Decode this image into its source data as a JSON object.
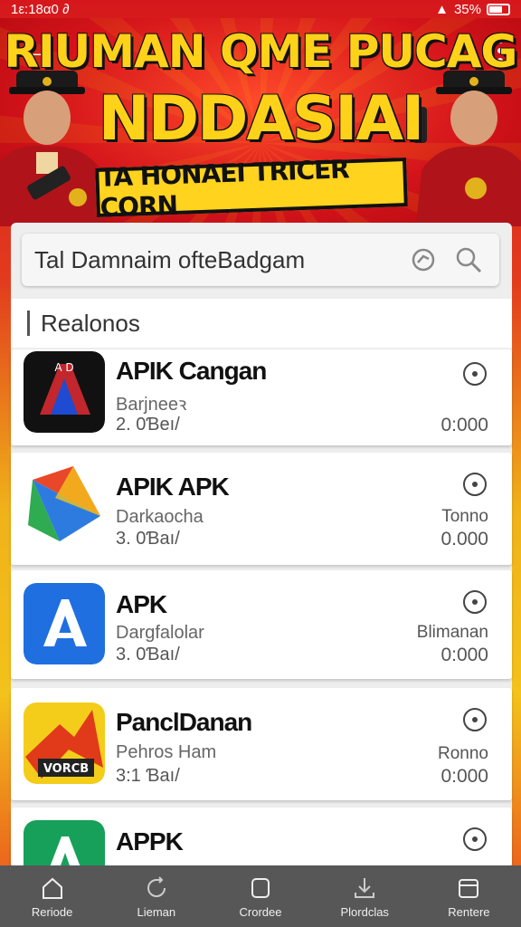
{
  "status": {
    "time": "1ε:18α0 ∂",
    "battery": "35%"
  },
  "banner": {
    "title_line1": "RIUMAN QME PUCAG",
    "title_line2": "NDDASIAI",
    "tagline": "TA HONAEI TRICER CORN"
  },
  "search": {
    "placeholder": "Tal Damnaim ofteBadgam"
  },
  "section": {
    "label": "Realonos"
  },
  "apps": [
    {
      "name": "APIK Cangan",
      "developer": "Barjneeꝛ",
      "size": "2. 0Ɓeı/",
      "extra": "",
      "count": "0:000",
      "icon": "apk-cangan-icon"
    },
    {
      "name": "APIK APK",
      "developer": "Darkaocha",
      "size": "3. 0Ɓaı/",
      "extra": "Tonno",
      "count": "0.000",
      "icon": "apk-triangle-icon"
    },
    {
      "name": "APK",
      "developer": "Dargfalolar",
      "size": "3. 0Ɓaı/",
      "extra": "Blimanan",
      "count": "0:000",
      "icon": "apk-blue-icon"
    },
    {
      "name": "PanclDanan",
      "developer": "Pehros Ham",
      "size": "3:1 Ɓaı/",
      "extra": "Ronno",
      "count": "0:000",
      "icon": "vorcb-icon"
    },
    {
      "name": "APPK",
      "developer": "",
      "size": "",
      "extra": "",
      "count": "",
      "icon": "appk-green-icon"
    }
  ],
  "nav": [
    {
      "label": "Reriode",
      "icon": "home-icon"
    },
    {
      "label": "Lieman",
      "icon": "refresh-icon"
    },
    {
      "label": "Crordee",
      "icon": "square-icon"
    },
    {
      "label": "Plordclas",
      "icon": "download-icon"
    },
    {
      "label": "Rentere",
      "icon": "box-icon"
    }
  ],
  "colors": {
    "banner_red": "#d3131a",
    "title_yellow": "#ffd21a",
    "navbar": "#575757"
  }
}
